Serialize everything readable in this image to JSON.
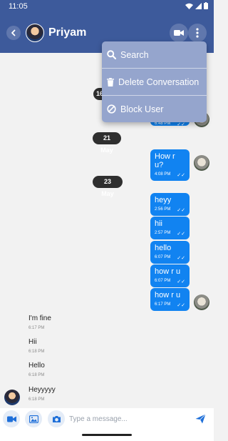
{
  "status_bar": {
    "time": "11:05"
  },
  "header": {
    "name": "Priyam"
  },
  "menu": {
    "items": [
      {
        "label": "Search",
        "icon": "search-icon"
      },
      {
        "label": "Delete Conversation",
        "icon": "trash-icon"
      },
      {
        "label": "Block User",
        "icon": "block-icon"
      }
    ]
  },
  "dates": [
    "16",
    "21 May",
    "23 May"
  ],
  "outgoing": [
    {
      "text": "How r u?",
      "time": "4:08 PM"
    },
    {
      "text": "heyy",
      "time": "2:56 PM"
    },
    {
      "text": "hii",
      "time": "2:57 PM"
    },
    {
      "text": "hello",
      "time": "6:07 PM"
    },
    {
      "text": "how r u",
      "time": "6:07 PM"
    },
    {
      "text": "how r u",
      "time": "6:17 PM"
    }
  ],
  "partial_bubble_time": "6:48 PM",
  "read_ticks": "✓✓",
  "incoming": [
    {
      "text": "I'm fine",
      "time": "6:17 PM"
    },
    {
      "text": "Hii",
      "time": "6:18 PM"
    },
    {
      "text": "Hello",
      "time": "6:18 PM"
    },
    {
      "text": "Heyyyyy",
      "time": "6:18 PM"
    }
  ],
  "input": {
    "placeholder": "Type a message..."
  },
  "colors": {
    "app_bar": "#3d5a9b",
    "bubble": "#1183f1",
    "menu": "#95a5cd",
    "date_chip": "#2f2f2f"
  }
}
